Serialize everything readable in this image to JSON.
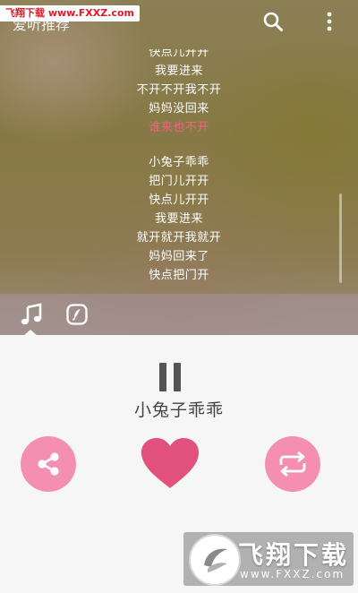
{
  "watermark_top": "飞翔下载 www.FXXZ.com",
  "page_title": "爱听推荐",
  "icons": {
    "search": "search-icon",
    "more": "more-vertical-icon",
    "music_tab": "music-note-icon",
    "lyric_tab": "lyric-icon",
    "share": "share-icon",
    "like": "heart-icon",
    "repeat": "repeat-icon",
    "pause": "pause-icon"
  },
  "lyrics": {
    "lines_a": [
      "快点儿开开",
      "我要进来",
      "不开不开我不开",
      "妈妈没回来"
    ],
    "active_line": "谁来也不开",
    "lines_b": [
      "小兔子乖乖",
      "把门儿开开",
      "快点儿开开",
      "我要进来",
      "就开就开我就开",
      "妈妈回来了",
      "快点把门开"
    ]
  },
  "player": {
    "song_title": "小兔子乖乖"
  },
  "logo_watermark": {
    "brand": "飞翔下载",
    "url": "www.FXXZ.com"
  },
  "colors": {
    "accent_pink": "#f58fb1",
    "heart": "#e2507e",
    "active_lyric": "#f06480"
  }
}
